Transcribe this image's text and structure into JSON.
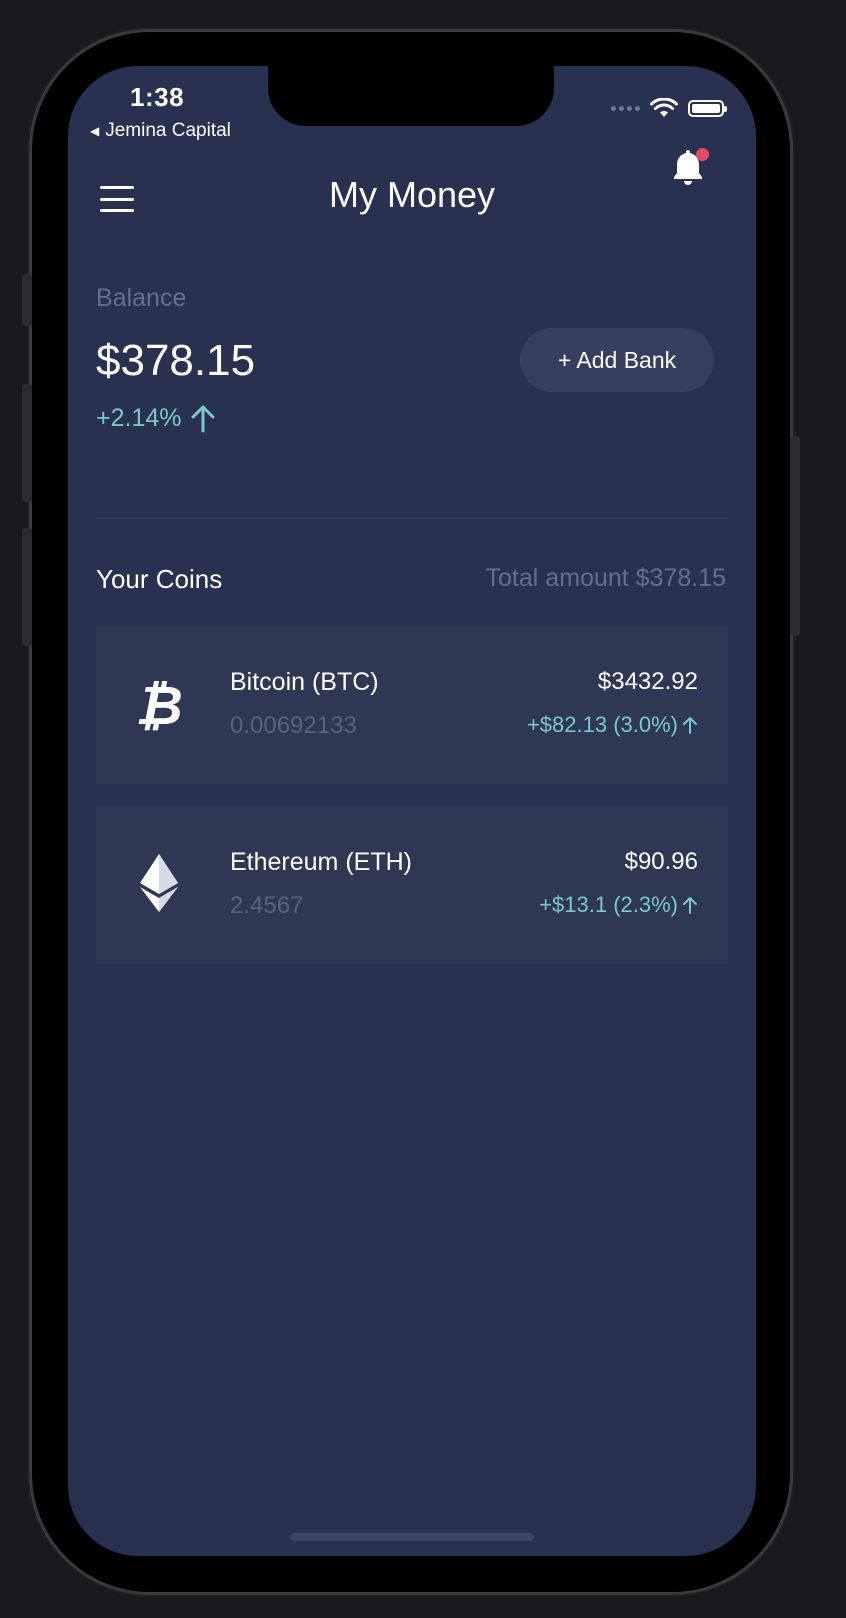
{
  "status_bar": {
    "time": "1:38",
    "back_app": "Jemina Capital"
  },
  "header": {
    "title": "My Money"
  },
  "balance": {
    "label": "Balance",
    "value": "$378.15",
    "change": "+2.14%",
    "add_bank_label": "+ Add Bank"
  },
  "coins": {
    "title": "Your Coins",
    "total": "Total amount $378.15",
    "items": [
      {
        "name": "Bitcoin (BTC)",
        "quantity": "0.00692133",
        "price": "$3432.92",
        "change": "+$82.13 (3.0%)",
        "icon": "bitcoin-icon"
      },
      {
        "name": "Ethereum (ETH)",
        "quantity": "2.4567",
        "price": "$90.96",
        "change": "+$13.1 (2.3%)",
        "icon": "ethereum-icon"
      }
    ]
  },
  "colors": {
    "background": "#283150",
    "card": "#2e3753",
    "accent_positive": "#7bc9c6",
    "muted_text": "#656e8c",
    "notification_dot": "#e34a65"
  }
}
